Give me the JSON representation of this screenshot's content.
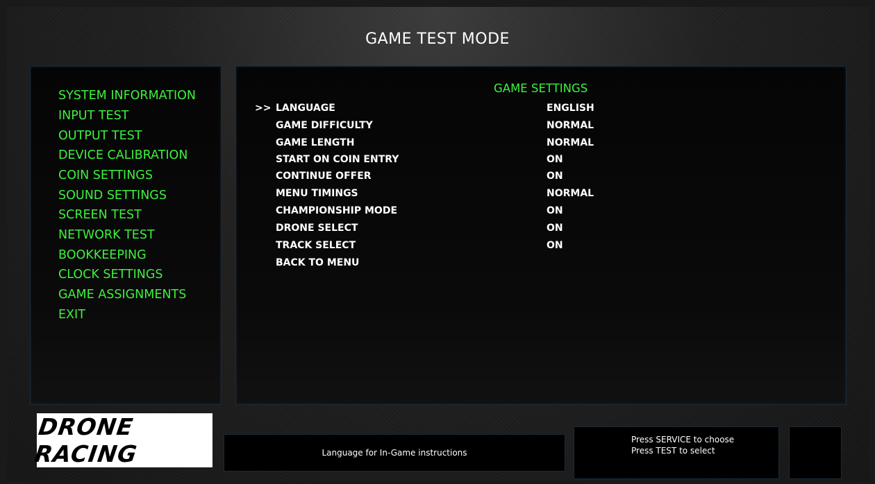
{
  "header": {
    "title": "GAME TEST MODE"
  },
  "sidebar": {
    "items": [
      {
        "label": "SYSTEM INFORMATION"
      },
      {
        "label": "INPUT TEST"
      },
      {
        "label": "OUTPUT TEST"
      },
      {
        "label": "DEVICE CALIBRATION"
      },
      {
        "label": "COIN SETTINGS"
      },
      {
        "label": "SOUND SETTINGS"
      },
      {
        "label": "SCREEN TEST"
      },
      {
        "label": "NETWORK TEST"
      },
      {
        "label": "BOOKKEEPING"
      },
      {
        "label": "CLOCK SETTINGS"
      },
      {
        "label": "GAME ASSIGNMENTS"
      },
      {
        "label": "EXIT"
      }
    ]
  },
  "main": {
    "section_title": "GAME SETTINGS",
    "cursor": ">>",
    "rows": [
      {
        "label": "LANGUAGE",
        "value": "ENGLISH"
      },
      {
        "label": "GAME DIFFICULTY",
        "value": "NORMAL"
      },
      {
        "label": "GAME LENGTH",
        "value": "NORMAL"
      },
      {
        "label": "START ON COIN ENTRY",
        "value": "ON"
      },
      {
        "label": "CONTINUE OFFER",
        "value": "ON"
      },
      {
        "label": "MENU TIMINGS",
        "value": "NORMAL"
      },
      {
        "label": "CHAMPIONSHIP MODE",
        "value": "ON"
      },
      {
        "label": "DRONE SELECT",
        "value": "ON"
      },
      {
        "label": "TRACK SELECT",
        "value": "ON"
      },
      {
        "label": "BACK TO MENU",
        "value": ""
      }
    ]
  },
  "footer": {
    "logo_text": "DRONE RACING",
    "help_text": "Language for In-Game instructions",
    "instructions": [
      "Press SERVICE to choose",
      "Press TEST to select"
    ]
  },
  "colors": {
    "menu_green": "#3ef03e",
    "text_white": "#ffffff",
    "panel_black": "#050505"
  }
}
